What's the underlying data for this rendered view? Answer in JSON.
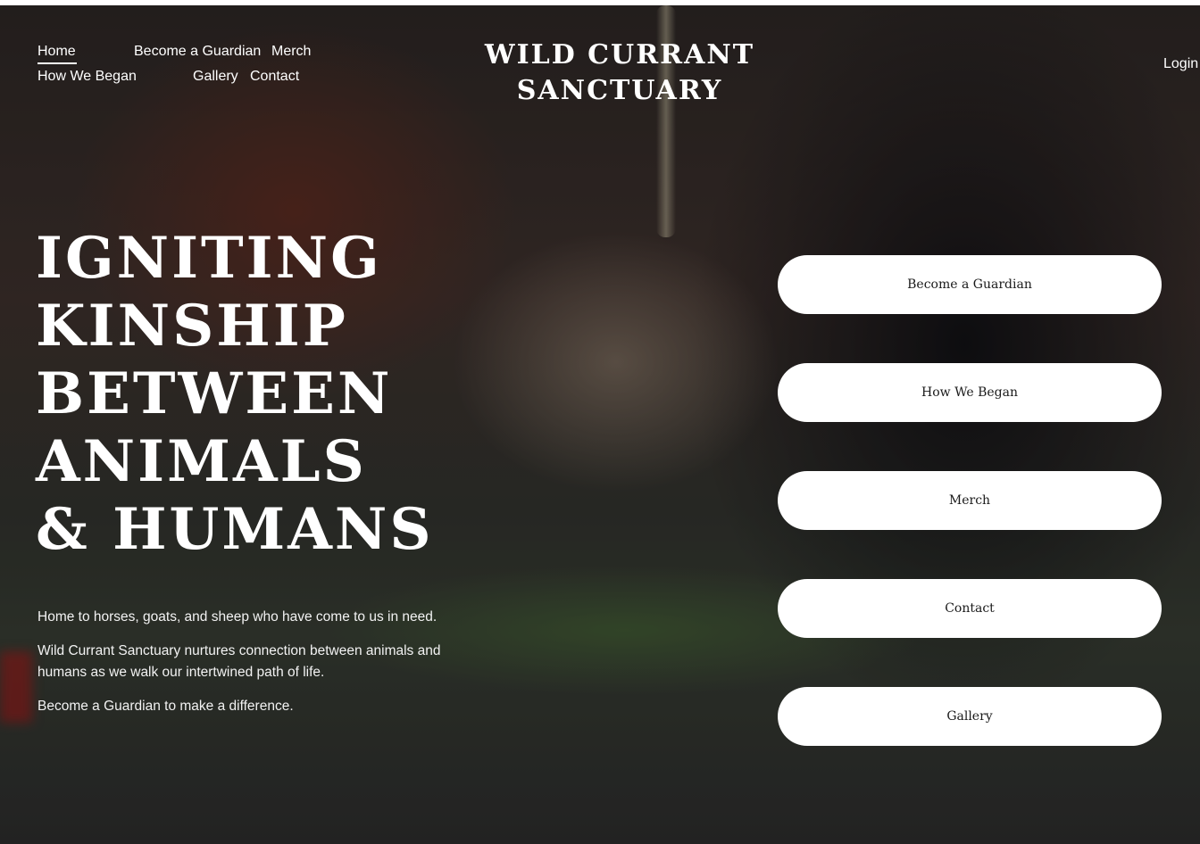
{
  "nav": {
    "row1": [
      "Home",
      "Become a Guardian",
      "Merch"
    ],
    "row2": [
      "How We Began",
      "Gallery",
      "Contact"
    ]
  },
  "site_title": {
    "line1": "WILD CURRANT",
    "line2": "SANCTUARY"
  },
  "login_label": "Login",
  "headline": [
    "IGNITING",
    "KINSHIP",
    "BETWEEN",
    "ANIMALS",
    "& HUMANS"
  ],
  "intro": {
    "p1": "Home to horses, goats, and sheep who have come to us in need.",
    "p2": "Wild Currant Sanctuary nurtures connection between animals and humans as we walk our intertwined path of life.",
    "p3": "Become a Guardian to make a difference."
  },
  "cta_buttons": [
    "Become a Guardian",
    "How We Began",
    "Merch",
    "Contact",
    "Gallery"
  ],
  "colors": {
    "text": "#ffffff",
    "button_bg": "#ffffff",
    "button_text": "#1a1a1a"
  }
}
